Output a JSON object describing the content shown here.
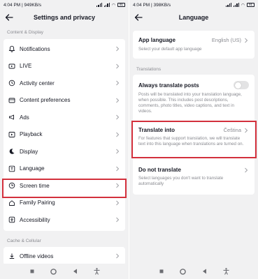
{
  "left": {
    "status": {
      "time_speed": "4:04 PM | 949KB/s",
      "battery": "91"
    },
    "title": "Settings and privacy",
    "section_content": "Content & Display",
    "items": [
      {
        "label": "Notifications",
        "icon": "bell-icon"
      },
      {
        "label": "LIVE",
        "icon": "live-icon"
      },
      {
        "label": "Activity center",
        "icon": "activity-icon"
      },
      {
        "label": "Content preferences",
        "icon": "video-icon"
      },
      {
        "label": "Ads",
        "icon": "megaphone-icon"
      },
      {
        "label": "Playback",
        "icon": "play-icon"
      },
      {
        "label": "Display",
        "icon": "moon-icon"
      },
      {
        "label": "Language",
        "icon": "language-icon"
      },
      {
        "label": "Screen time",
        "icon": "clock-icon"
      },
      {
        "label": "Family Pairing",
        "icon": "home-icon"
      },
      {
        "label": "Accessibility",
        "icon": "accessibility-icon"
      }
    ],
    "section_cache": "Cache & Cellular",
    "offline": {
      "label": "Offline videos",
      "icon": "download-icon"
    }
  },
  "right": {
    "status": {
      "time_speed": "4:04 PM | 398KB/s",
      "battery": "91"
    },
    "title": "Language",
    "app_language": {
      "title": "App language",
      "value": "English (US)",
      "subtitle": "Select your default app language"
    },
    "section_translations": "Translations",
    "always_translate": {
      "title": "Always translate posts",
      "description": "Posts will be translated into your translation language, when possible. This includes post descriptions, comments, photo titles, video captions, and text in videos.",
      "enabled": false
    },
    "translate_into": {
      "title": "Translate into",
      "value": "Čeština",
      "description": "For features that support translation, we will translate text into this language when translations are turned on."
    },
    "do_not_translate": {
      "title": "Do not translate",
      "description": "Select languages you don't want to translate automatically"
    }
  },
  "colors": {
    "highlight": "#d3303c",
    "background": "#f1f1f2",
    "card": "#ffffff",
    "secondary_text": "#8a8b91"
  }
}
